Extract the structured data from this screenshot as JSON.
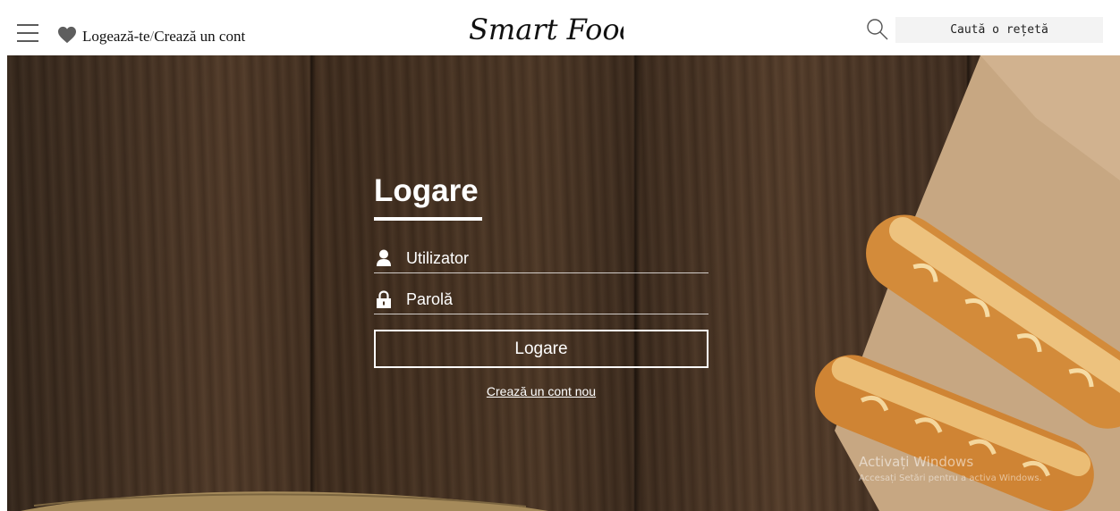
{
  "header": {
    "login_label": "Logează-te",
    "separator": "/",
    "register_label": "Crează un cont",
    "logo_text": "Smart Food",
    "search_placeholder": "Caută o rețetă"
  },
  "login_form": {
    "title": "Logare",
    "username_placeholder": "Utilizator",
    "password_placeholder": "Parolă",
    "submit_label": "Logare",
    "register_link": "Crează un cont nou"
  },
  "watermark": {
    "title": "Activați Windows",
    "subtitle": "Accesați Setări pentru a activa Windows."
  },
  "colors": {
    "accent": "#ffffff",
    "header_bg": "#ffffff",
    "search_bg": "#f3f3f3",
    "wood": "#4a3524"
  },
  "icons": [
    "menu-icon",
    "heart-icon",
    "search-icon",
    "user-icon",
    "lock-icon"
  ]
}
